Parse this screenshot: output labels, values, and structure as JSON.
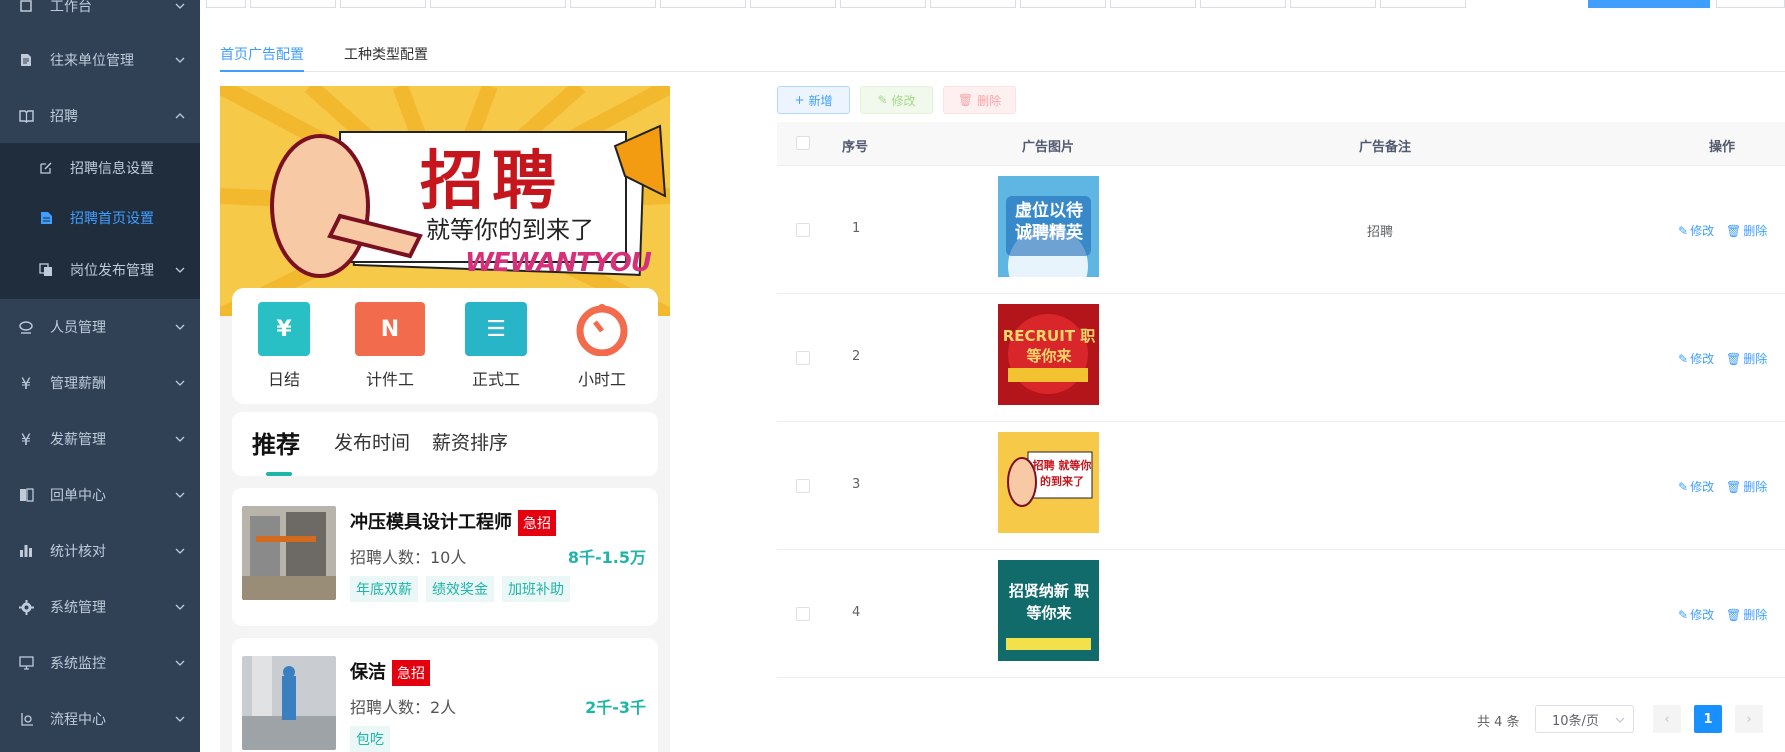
{
  "sidebar": {
    "items": [
      {
        "label": "工作台",
        "icon": "home-icon"
      },
      {
        "label": "往来单位管理",
        "icon": "document-icon"
      },
      {
        "label": "招聘",
        "icon": "book-icon",
        "expanded": true,
        "children": [
          {
            "label": "招聘信息设置",
            "icon": "edit-icon"
          },
          {
            "label": "招聘首页设置",
            "icon": "file-icon",
            "active": true
          },
          {
            "label": "岗位发布管理",
            "icon": "copy-icon"
          }
        ]
      },
      {
        "label": "人员管理",
        "icon": "users-icon"
      },
      {
        "label": "管理薪酬",
        "icon": "yen-icon"
      },
      {
        "label": "发薪管理",
        "icon": "yen-icon"
      },
      {
        "label": "回单中心",
        "icon": "receipt-icon"
      },
      {
        "label": "统计核对",
        "icon": "bar-chart-icon"
      },
      {
        "label": "系统管理",
        "icon": "gear-icon"
      },
      {
        "label": "系统监控",
        "icon": "monitor-icon"
      },
      {
        "label": "流程中心",
        "icon": "flow-icon"
      }
    ]
  },
  "subtabs": [
    "首页广告配置",
    "工种类型配置"
  ],
  "preview": {
    "banner": {
      "headline": "招聘",
      "sub": "就等你的到来了",
      "tagline": "WEWANTYOU"
    },
    "quick": [
      "日结",
      "计件工",
      "正式工",
      "小时工"
    ],
    "sort_tabs": [
      "推荐",
      "发布时间",
      "薪资排序"
    ],
    "jobs": [
      {
        "title": "冲压模具设计工程师",
        "badge": "急招",
        "count": "招聘人数：10人",
        "salary": "8千-1.5万",
        "tags": [
          "年底双薪",
          "绩效奖金",
          "加班补助"
        ]
      },
      {
        "title": "保洁",
        "badge": "急招",
        "count": "招聘人数：2人",
        "salary": "2千-3千",
        "tags": [
          "包吃"
        ]
      }
    ]
  },
  "toolbar": {
    "add": "新增",
    "edit": "修改",
    "delete": "删除"
  },
  "table": {
    "headers": [
      "序号",
      "广告图片",
      "广告备注",
      "操作"
    ],
    "rows": [
      {
        "index": "1",
        "remark": "招聘",
        "img_text": "虚位以待 诚聘精英"
      },
      {
        "index": "2",
        "remark": "",
        "img_text": "RECRUIT 职等你来"
      },
      {
        "index": "3",
        "remark": "",
        "img_text": "招聘 就等你的到来了"
      },
      {
        "index": "4",
        "remark": "",
        "img_text": "招贤纳新 职等你来"
      }
    ],
    "row_ops": [
      "修改",
      "删除"
    ]
  },
  "pagination": {
    "total": "共 4 条",
    "page_size": "10条/页",
    "current": "1"
  },
  "colors": {
    "sidebar": "#304156",
    "accent": "#409eff",
    "teal": "#1fb5a8",
    "urgent": "#e4000f"
  }
}
